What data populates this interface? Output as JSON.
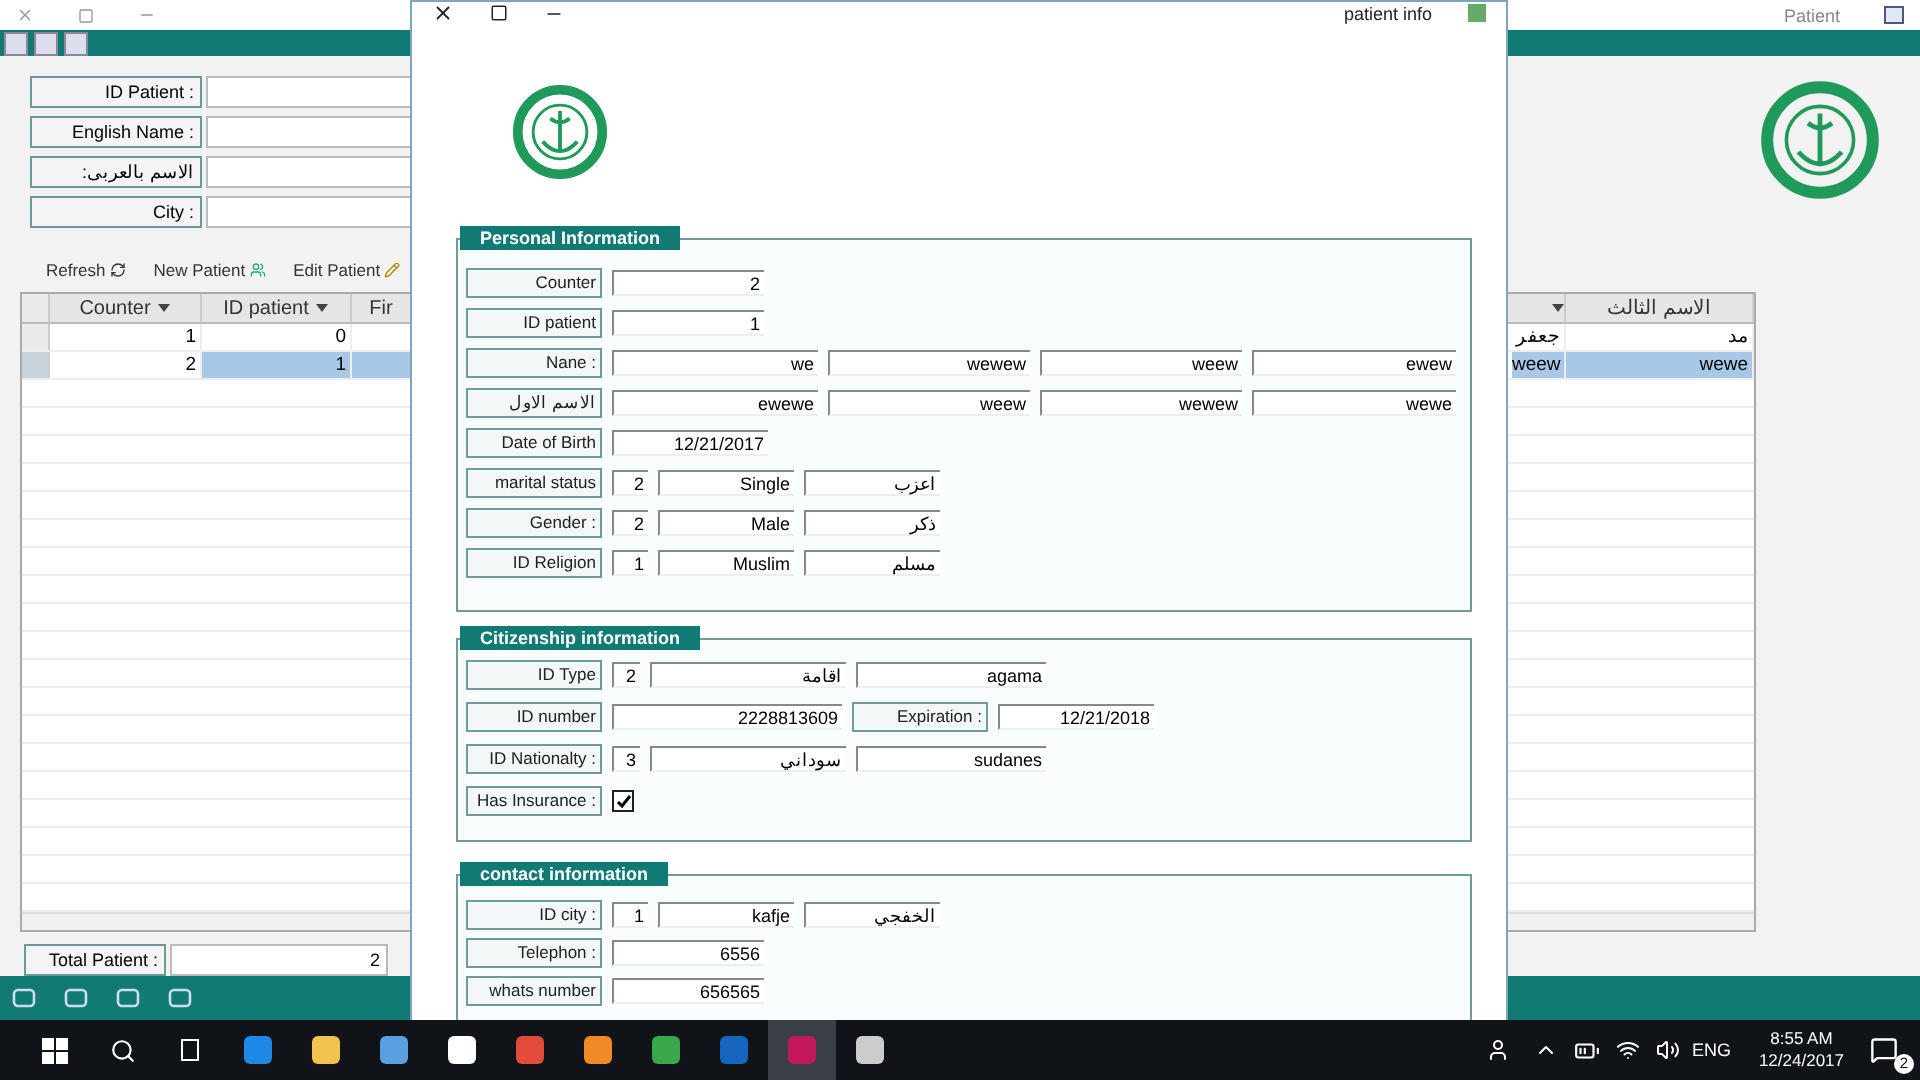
{
  "app": {
    "title": "Patient",
    "search_fields": [
      {
        "label": "ID Patient :"
      },
      {
        "label": "English Name :"
      },
      {
        "label": ":الاسم بالعربى"
      },
      {
        "label": "City :"
      }
    ],
    "toolbar": [
      {
        "label": "Refresh"
      },
      {
        "label": "New Patient"
      },
      {
        "label": "Edit Patient"
      }
    ],
    "grid": {
      "columns": [
        {
          "header": "Counter",
          "arrow": true
        },
        {
          "header": "ID patient",
          "arrow": true
        },
        {
          "header": "Fir",
          "arrow": false
        },
        {
          "arrow": true
        },
        {
          "header": "الاسم الثالث",
          "arrow": false
        }
      ],
      "rows": [
        {
          "selected": false,
          "cells": [
            "1",
            "0",
            null,
            "جعفر",
            "مد"
          ]
        },
        {
          "selected": true,
          "cells": [
            "2",
            "1",
            null,
            "weew",
            "wewe"
          ]
        }
      ]
    },
    "total": {
      "label": "Total Patient :",
      "value": "2"
    }
  },
  "dialog": {
    "title": "patient info",
    "sections": [
      {
        "title": "Personal Information",
        "rows": [
          {
            "label": "Counter",
            "kind": "single",
            "values": [
              "2"
            ]
          },
          {
            "label": "ID patient",
            "kind": "single",
            "values": [
              "1"
            ]
          },
          {
            "label": "Nane :",
            "kind": "name",
            "values": [
              "we",
              "wewew",
              "weew",
              "ewew"
            ]
          },
          {
            "label": "الاسم الاول",
            "kind": "name",
            "values": [
              "ewewe",
              "weew",
              "wewew",
              "wewe"
            ]
          },
          {
            "label": "Date of Birth",
            "kind": "date",
            "values": [
              "12/21/2017"
            ]
          },
          {
            "label": "marital status",
            "kind": "lookup",
            "values": [
              "2",
              "Single",
              "اعزب"
            ]
          },
          {
            "label": "Gender :",
            "kind": "lookup",
            "values": [
              "2",
              "Male",
              "ذكر"
            ]
          },
          {
            "label": "ID Religion",
            "kind": "lookup",
            "values": [
              "1",
              "Muslim",
              "مسلم"
            ]
          }
        ]
      },
      {
        "title": "Citizenship information",
        "rows": [
          {
            "label": "ID Type",
            "kind": "lookup-wide",
            "values": [
              "2",
              "اقامة",
              "agama"
            ]
          },
          {
            "label": "ID number",
            "kind": "pair",
            "values": [
              "2228813609",
              "12/21/2018"
            ],
            "second_label": "Expiration :"
          },
          {
            "label": "ID Nationalty :",
            "kind": "lookup-wide",
            "values": [
              "3",
              "سوداني",
              "sudanes"
            ]
          },
          {
            "label": "Has Insurance :",
            "kind": "check",
            "checked": true
          }
        ]
      },
      {
        "title": "contact information",
        "rows": [
          {
            "label": "ID city :",
            "kind": "lookup",
            "values": [
              "1",
              "kafje",
              "الخفجي"
            ]
          },
          {
            "label": "Telephon :",
            "kind": "single",
            "values": [
              "6556"
            ]
          },
          {
            "label": "whats number",
            "kind": "single",
            "values": [
              "656565"
            ]
          }
        ]
      }
    ]
  },
  "taskbar": {
    "language": "ENG",
    "time": "8:55 AM",
    "date": "12/24/2017",
    "notifications": "2"
  }
}
